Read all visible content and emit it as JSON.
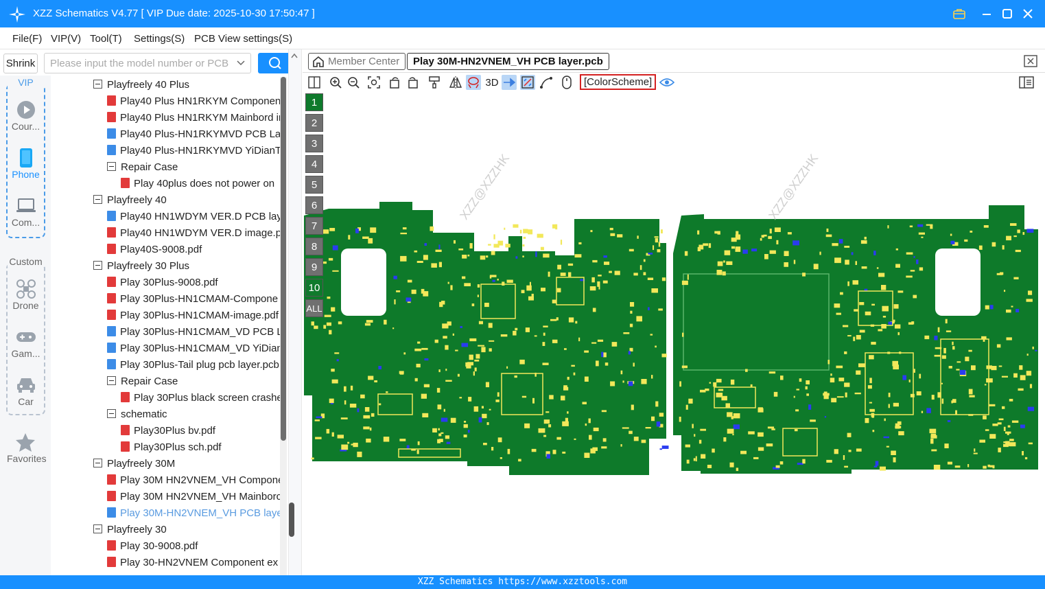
{
  "window": {
    "title": "XZZ Schematics V4.77 [ VIP Due date: 2025-10-30 17:50:47 ]",
    "accent": "#1890ff"
  },
  "menu": [
    "File(F)",
    "VIP(V)",
    "Tool(T)",
    "Settings(S)",
    "PCB View settings(S)"
  ],
  "sidebar": {
    "shrink_label": "Shrink",
    "search_placeholder": "Please input the model number or PCB",
    "vip_label": "VIP",
    "custom_label": "Custom",
    "vip_items": [
      {
        "label": "Cour...",
        "icon": "play-circle-icon"
      },
      {
        "label": "Phone",
        "icon": "phone-icon"
      },
      {
        "label": "Com...",
        "icon": "laptop-icon"
      }
    ],
    "custom_items": [
      {
        "label": "Drone",
        "icon": "drone-icon"
      },
      {
        "label": "Gam...",
        "icon": "gamepad-icon"
      },
      {
        "label": "Car",
        "icon": "car-icon"
      }
    ],
    "favorites_label": "Favorites"
  },
  "tree": [
    {
      "level": 0,
      "type": "folder",
      "label": "Playfreely 40 Plus"
    },
    {
      "level": 1,
      "type": "pdf",
      "label": "Play40 Plus HN1RKYM Component"
    },
    {
      "level": 1,
      "type": "pdf",
      "label": "Play40 Plus HN1RKYM Mainbord in"
    },
    {
      "level": 1,
      "type": "pcb",
      "label": "Play40 Plus-HN1RKYMVD PCB Laye"
    },
    {
      "level": 1,
      "type": "pcb",
      "label": "Play40 Plus-HN1RKYMVD YiDianTo"
    },
    {
      "level": 1,
      "type": "folder",
      "label": "Repair Case"
    },
    {
      "level": 2,
      "type": "pdf",
      "label": "Play 40plus does not power on"
    },
    {
      "level": 0,
      "type": "folder",
      "label": "Playfreely 40"
    },
    {
      "level": 1,
      "type": "pcb",
      "label": "Play40 HN1WDYM VER.D PCB laye"
    },
    {
      "level": 1,
      "type": "pdf",
      "label": "Play40 HN1WDYM VER.D image.pd"
    },
    {
      "level": 1,
      "type": "pdf",
      "label": "Play40S-9008.pdf"
    },
    {
      "level": 0,
      "type": "folder",
      "label": "Playfreely 30 Plus"
    },
    {
      "level": 1,
      "type": "pdf",
      "label": "Play 30Plus-9008.pdf"
    },
    {
      "level": 1,
      "type": "pdf",
      "label": "Play 30Plus-HN1CMAM-Compone"
    },
    {
      "level": 1,
      "type": "pdf",
      "label": "Play 30Plus-HN1CMAM-image.pdf"
    },
    {
      "level": 1,
      "type": "pcb",
      "label": "Play 30Plus-HN1CMAM_VD PCB La"
    },
    {
      "level": 1,
      "type": "pcb",
      "label": "Play 30Plus-HN1CMAM_VD YiDian"
    },
    {
      "level": 1,
      "type": "pcb",
      "label": "Play 30Plus-Tail plug pcb layer.pcb"
    },
    {
      "level": 1,
      "type": "folder",
      "label": "Repair Case"
    },
    {
      "level": 2,
      "type": "pdf",
      "label": "Play 30Plus black screen crashe"
    },
    {
      "level": 1,
      "type": "folder",
      "label": "schematic"
    },
    {
      "level": 2,
      "type": "pdf",
      "label": "Play30Plus bv.pdf"
    },
    {
      "level": 2,
      "type": "pdf",
      "label": "Play30Plus sch.pdf"
    },
    {
      "level": 0,
      "type": "folder",
      "label": "Playfreely 30M"
    },
    {
      "level": 1,
      "type": "pdf",
      "label": "Play 30M HN2VNEM_VH Compone"
    },
    {
      "level": 1,
      "type": "pdf",
      "label": "Play 30M HN2VNEM_VH Mainborc"
    },
    {
      "level": 1,
      "type": "pcb",
      "label": "Play 30M-HN2VNEM_VH PCB layer",
      "selected": true
    },
    {
      "level": 0,
      "type": "folder",
      "label": "Playfreely 30"
    },
    {
      "level": 1,
      "type": "pdf",
      "label": "Play 30-9008.pdf"
    },
    {
      "level": 1,
      "type": "pdf",
      "label": "Play 30-HN2VNEM Component ex"
    }
  ],
  "tabs": {
    "member_center": "Member Center",
    "active_file": "Play 30M-HN2VNEM_VH PCB layer.pcb"
  },
  "toolbar": {
    "three_d_label": "3D",
    "color_scheme_label": "[ColorScheme]"
  },
  "layers": [
    "1",
    "2",
    "3",
    "4",
    "5",
    "6",
    "7",
    "8",
    "9",
    "10",
    "ALL"
  ],
  "active_layers": [
    "1",
    "10"
  ],
  "watermark": "XZZ@XZZHK",
  "footer": "XZZ Schematics https://www.xzztools.com",
  "colors": {
    "pcb_green": "#0e7a2a",
    "pad_yellow": "#f2e85a",
    "via_blue": "#2a3cf0"
  }
}
